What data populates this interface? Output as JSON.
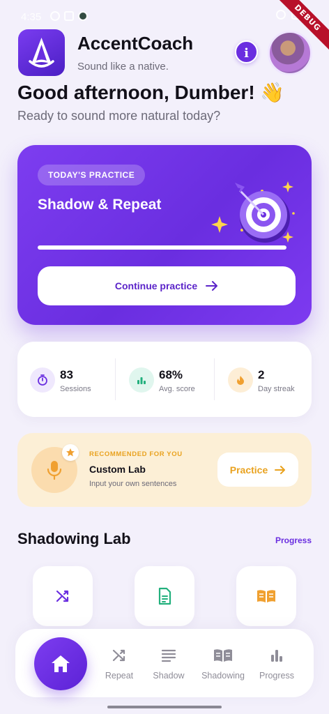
{
  "status_bar": {
    "time": "4:35",
    "debug": "DEBUG"
  },
  "header": {
    "app_name": "AccentCoach",
    "tagline": "Sound like a native.",
    "info_label": "i"
  },
  "greeting": {
    "title": "Good afternoon, Dumber! 👋",
    "subtitle": "Ready to sound more natural today?"
  },
  "practice": {
    "badge": "TODAY'S PRACTICE",
    "title": "Shadow & Repeat",
    "progress": 1.0,
    "button_label": "Continue practice"
  },
  "stats": [
    {
      "value": "83",
      "label": "Sessions",
      "icon": "timer-icon",
      "color": "#6a2ee0"
    },
    {
      "value": "68%",
      "label": "Avg. score",
      "icon": "bar-chart-icon",
      "color": "#22b07d"
    },
    {
      "value": "2",
      "label": "Day streak",
      "icon": "fire-icon",
      "color": "#f0a030"
    }
  ],
  "recommended": {
    "eyebrow": "RECOMMENDED FOR YOU",
    "title": "Custom Lab",
    "subtitle": "Input your own sentences",
    "button_label": "Practice"
  },
  "section": {
    "title": "Shadowing Lab",
    "link": "Progress"
  },
  "lab_tiles": [
    {
      "icon": "shuffle-icon",
      "color": "#6a2ee0"
    },
    {
      "icon": "document-icon",
      "color": "#22b07d"
    },
    {
      "icon": "book-icon",
      "color": "#f0a030"
    }
  ],
  "bottom_nav": {
    "items": [
      {
        "label": "Repeat"
      },
      {
        "label": "Shadow"
      },
      {
        "label": "Shadowing"
      },
      {
        "label": "Progress"
      }
    ]
  },
  "colors": {
    "accent": "#6a2ee0",
    "background": "#f3f0fb",
    "warm": "#f0a030",
    "green": "#22b07d"
  }
}
